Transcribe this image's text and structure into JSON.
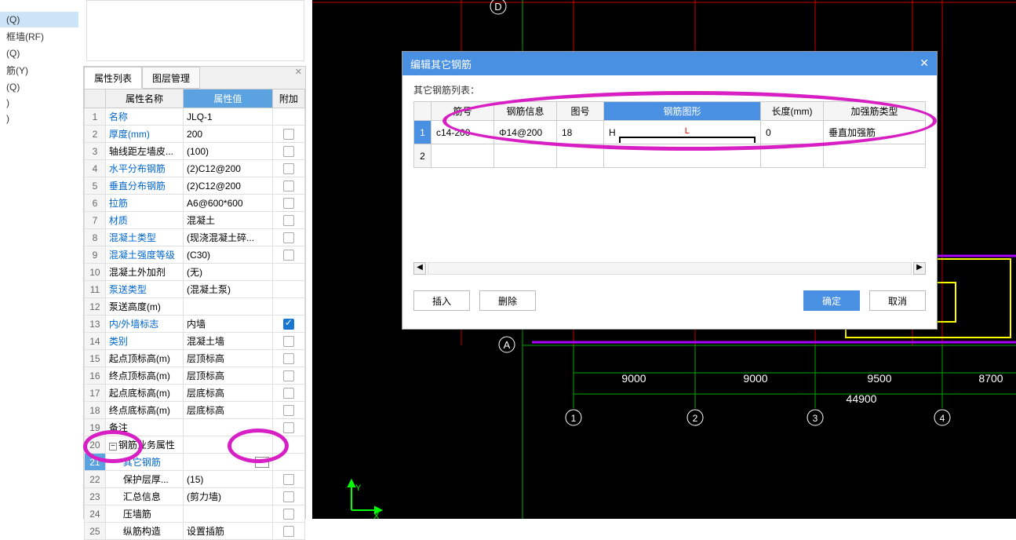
{
  "sidebar": {
    "items": [
      {
        "label": "(Q)",
        "selected": true
      },
      {
        "label": "框墙(RF)",
        "selected": false
      },
      {
        "label": "(Q)",
        "selected": false
      },
      {
        "label": "筋(Y)",
        "selected": false
      },
      {
        "label": "(Q)",
        "selected": false
      },
      {
        "label": ")",
        "selected": false
      },
      {
        "label": ")",
        "selected": false
      }
    ]
  },
  "prop_panel": {
    "tab1": "属性列表",
    "tab2": "图层管理",
    "headers": {
      "name": "属性名称",
      "value": "属性值",
      "extra": "附加"
    },
    "rows": [
      {
        "n": "1",
        "name": "名称",
        "link": true,
        "val": "JLQ-1",
        "chk": false
      },
      {
        "n": "2",
        "name": "厚度(mm)",
        "link": true,
        "val": "200",
        "chk": true
      },
      {
        "n": "3",
        "name": "轴线距左墙皮...",
        "link": false,
        "val": "(100)",
        "chk": true
      },
      {
        "n": "4",
        "name": "水平分布钢筋",
        "link": true,
        "val": "(2)C12@200",
        "chk": true
      },
      {
        "n": "5",
        "name": "垂直分布钢筋",
        "link": true,
        "val": "(2)C12@200",
        "chk": true
      },
      {
        "n": "6",
        "name": "拉筋",
        "link": true,
        "val": "A6@600*600",
        "chk": true
      },
      {
        "n": "7",
        "name": "材质",
        "link": true,
        "val": "混凝土",
        "chk": true
      },
      {
        "n": "8",
        "name": "混凝土类型",
        "link": true,
        "val": "(现浇混凝土碎...",
        "chk": true
      },
      {
        "n": "9",
        "name": "混凝土强度等级",
        "link": true,
        "val": "(C30)",
        "chk": true
      },
      {
        "n": "10",
        "name": "混凝土外加剂",
        "link": false,
        "val": "(无)",
        "chk": false
      },
      {
        "n": "11",
        "name": "泵送类型",
        "link": true,
        "val": "(混凝土泵)",
        "chk": false
      },
      {
        "n": "12",
        "name": "泵送高度(m)",
        "link": false,
        "val": "",
        "chk": false
      },
      {
        "n": "13",
        "name": "内/外墙标志",
        "link": true,
        "val": "内墙",
        "chk": true,
        "checked": true
      },
      {
        "n": "14",
        "name": "类别",
        "link": true,
        "val": "混凝土墙",
        "chk": true
      },
      {
        "n": "15",
        "name": "起点顶标高(m)",
        "link": false,
        "val": "层顶标高",
        "chk": true
      },
      {
        "n": "16",
        "name": "终点顶标高(m)",
        "link": false,
        "val": "层顶标高",
        "chk": true
      },
      {
        "n": "17",
        "name": "起点底标高(m)",
        "link": false,
        "val": "层底标高",
        "chk": true
      },
      {
        "n": "18",
        "name": "终点底标高(m)",
        "link": false,
        "val": "层底标高",
        "chk": true
      },
      {
        "n": "19",
        "name": "备注",
        "link": false,
        "val": "",
        "chk": true
      },
      {
        "n": "20",
        "name": "钢筋业务属性",
        "link": false,
        "val": "",
        "expand": true
      },
      {
        "n": "21",
        "name": "其它钢筋",
        "link": true,
        "val": "",
        "ellipsis": true,
        "indent": true,
        "selected": true
      },
      {
        "n": "22",
        "name": "保护层厚...",
        "link": false,
        "val": "(15)",
        "chk": true,
        "indent": true
      },
      {
        "n": "23",
        "name": "汇总信息",
        "link": false,
        "val": "(剪力墙)",
        "chk": true,
        "indent": true
      },
      {
        "n": "24",
        "name": "压墙筋",
        "link": false,
        "val": "",
        "chk": true,
        "indent": true
      },
      {
        "n": "25",
        "name": "纵筋构造",
        "link": false,
        "val": "设置插筋",
        "chk": true,
        "indent": true
      }
    ]
  },
  "dialog": {
    "title": "编辑其它钢筋",
    "list_label": "其它钢筋列表：",
    "headers": {
      "num": "筋号",
      "info": "钢筋信息",
      "shape_num": "图号",
      "shape": "钢筋图形",
      "length": "长度(mm)",
      "type": "加强筋类型"
    },
    "rows": [
      {
        "rn": "1",
        "num": "c14-200",
        "info": "Φ14@200",
        "shape_num": "18",
        "shape_h": "H",
        "shape_l": "L",
        "length": "0",
        "type": "垂直加强筋",
        "selected": true
      },
      {
        "rn": "2"
      }
    ],
    "buttons": {
      "insert": "插入",
      "delete": "删除",
      "ok": "确定",
      "cancel": "取消"
    }
  },
  "cad": {
    "axis_letters": {
      "d": "D",
      "a": "A"
    },
    "axis_numbers": [
      "1",
      "2",
      "3",
      "4"
    ],
    "dims": [
      "9000",
      "9000",
      "9500",
      "8700"
    ],
    "total": "44900",
    "ucs": {
      "x": "X",
      "y": "Y"
    }
  }
}
